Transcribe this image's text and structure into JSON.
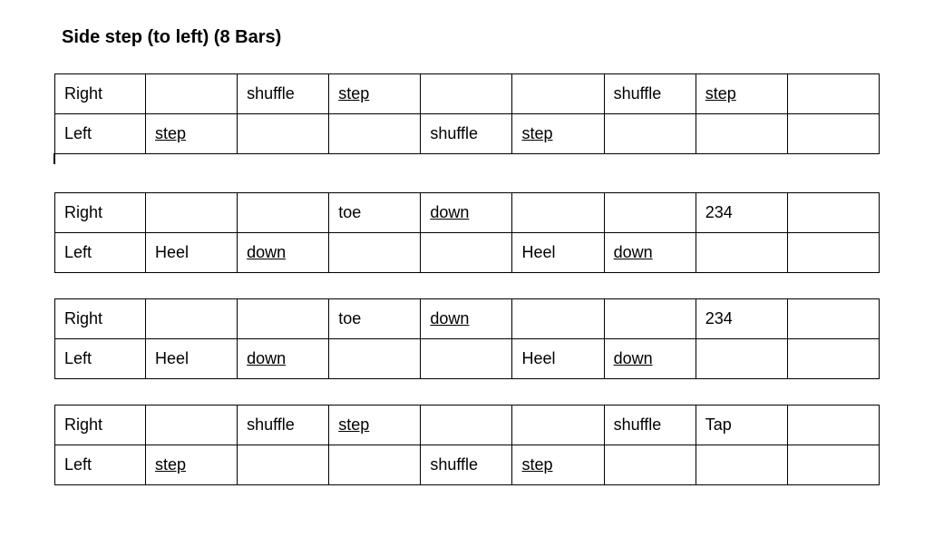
{
  "title": "Side step (to left) (8 Bars)",
  "blocks": [
    {
      "rows": [
        {
          "label": "Right",
          "cells": [
            "",
            "shuffle",
            {
              "t": "step",
              "u": true
            },
            "",
            "",
            "shuffle",
            {
              "t": "step",
              "u": true
            },
            ""
          ]
        },
        {
          "label": "Left",
          "cells": [
            {
              "t": "step",
              "u": true
            },
            "",
            "",
            "shuffle",
            {
              "t": "step",
              "u": true
            },
            "",
            "",
            ""
          ]
        }
      ],
      "tick_after": true
    },
    {
      "rows": [
        {
          "label": "Right",
          "cells": [
            "",
            "",
            "toe",
            {
              "t": "down",
              "u": true
            },
            "",
            "",
            "234",
            ""
          ]
        },
        {
          "label": "Left",
          "cells": [
            "Heel",
            {
              "t": "down",
              "u": true
            },
            "",
            "",
            "Heel",
            {
              "t": "down",
              "u": true
            },
            "",
            ""
          ]
        }
      ]
    },
    {
      "rows": [
        {
          "label": "Right",
          "cells": [
            "",
            "",
            "toe",
            {
              "t": "down",
              "u": true
            },
            "",
            "",
            "234",
            ""
          ]
        },
        {
          "label": "Left",
          "cells": [
            "Heel",
            {
              "t": "down",
              "u": true
            },
            "",
            "",
            "Heel",
            {
              "t": "down",
              "u": true
            },
            "",
            ""
          ]
        }
      ]
    },
    {
      "rows": [
        {
          "label": "Right",
          "cells": [
            "",
            "shuffle",
            {
              "t": "step",
              "u": true
            },
            "",
            "",
            "shuffle",
            "Tap",
            ""
          ]
        },
        {
          "label": "Left",
          "cells": [
            {
              "t": "step",
              "u": true
            },
            "",
            "",
            "shuffle",
            {
              "t": "step",
              "u": true
            },
            "",
            "",
            ""
          ]
        }
      ]
    }
  ]
}
